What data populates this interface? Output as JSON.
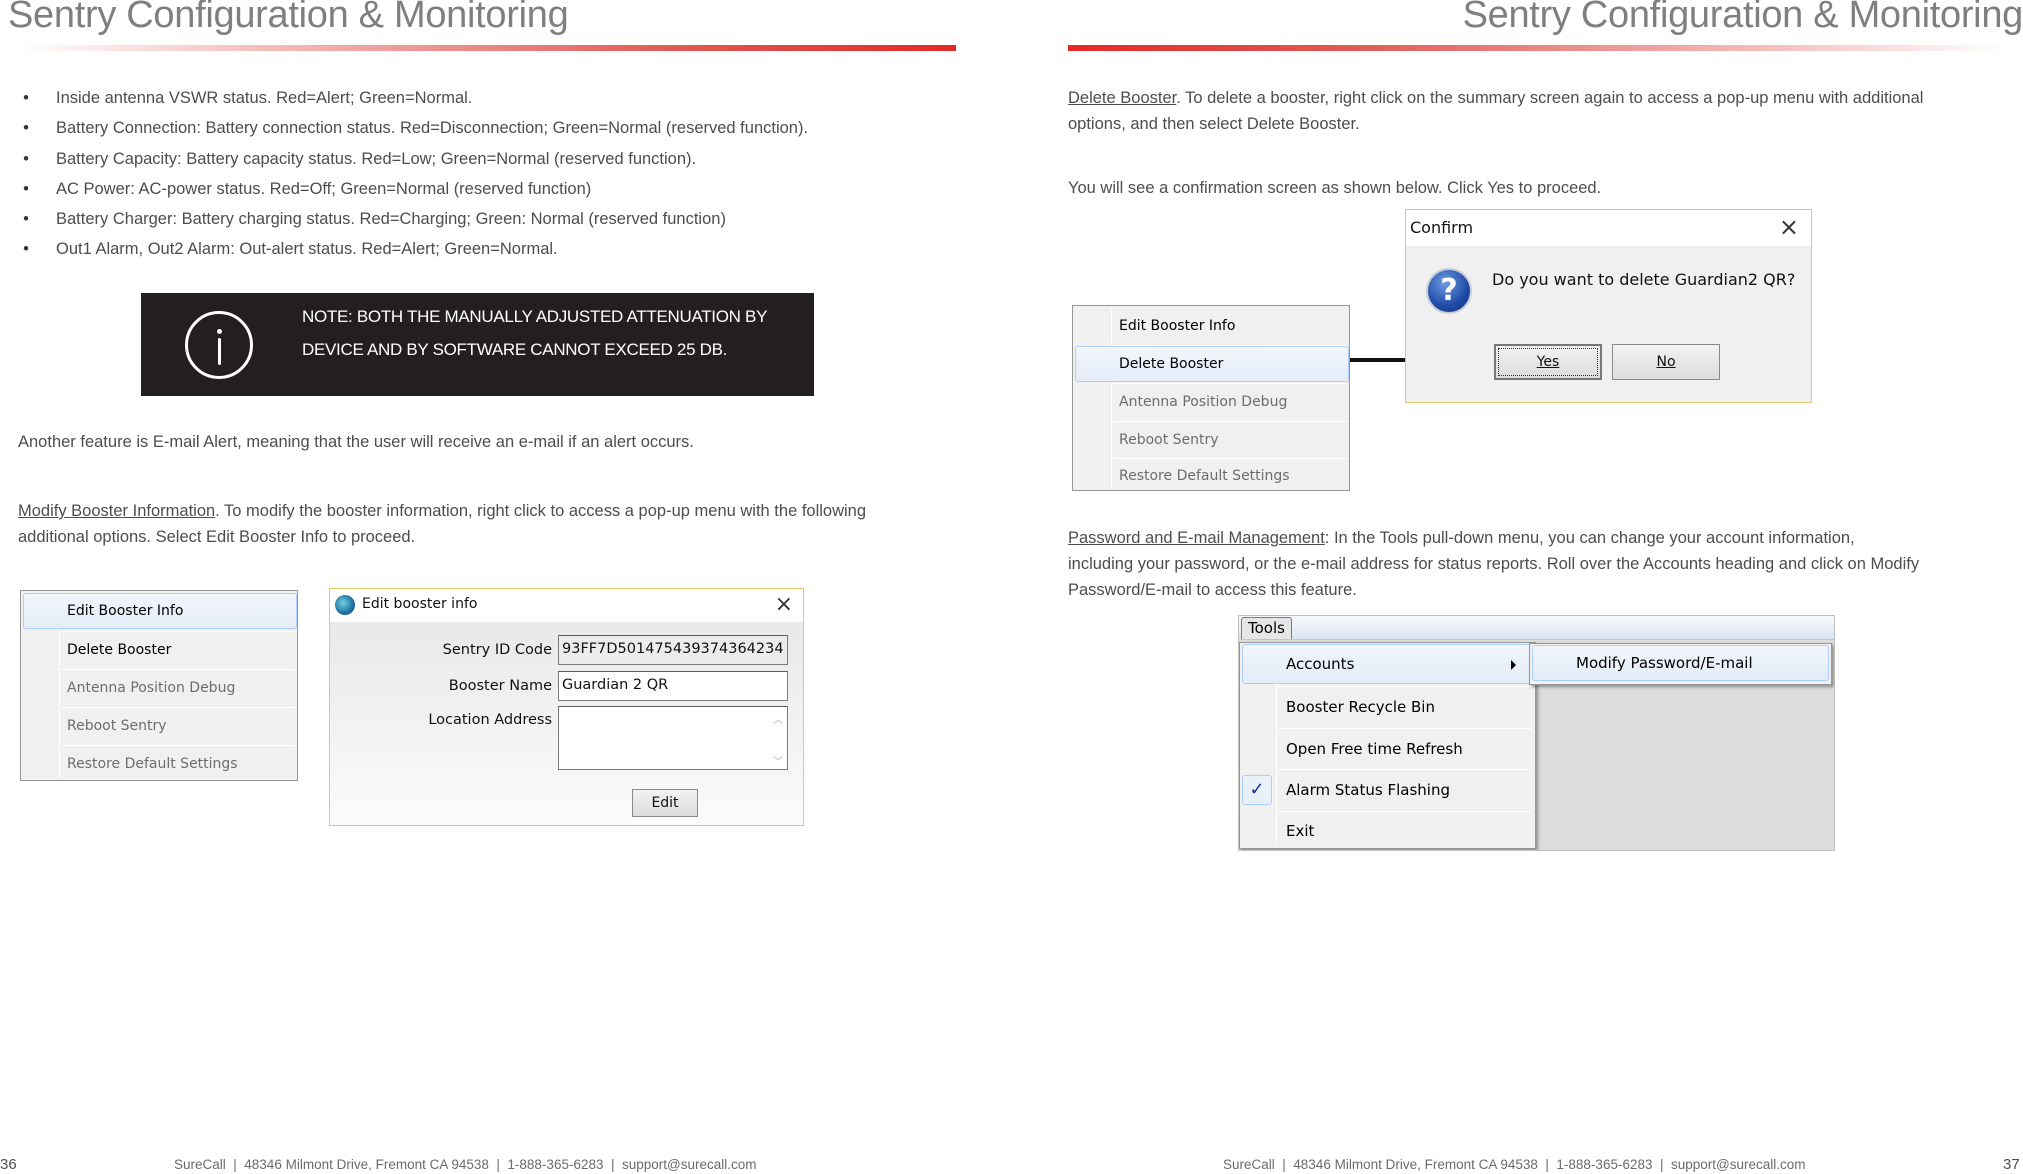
{
  "left_page": {
    "title": "Sentry Configuration & Monitoring",
    "bullets": [
      "Inside antenna VSWR status. Red=Alert; Green=Normal.",
      "Battery Connection: Battery connection status. Red=Disconnection; Green=Normal (reserved function).",
      "Battery Capacity: Battery capacity status. Red=Low; Green=Normal (reserved function).",
      "AC Power: AC-power status. Red=Off; Green=Normal (reserved function)",
      "Battery Charger: Battery charging status. Red=Charging; Green: Normal (reserved function)",
      "Out1 Alarm, Out2 Alarm: Out-alert status. Red=Alert; Green=Normal."
    ],
    "note": {
      "icon": "info-icon",
      "line1": "NOTE: BOTH THE MANUALLY ADJUSTED ATTENUATION BY",
      "line2": "DEVICE AND BY SOFTWARE CANNOT EXCEED 25 DB."
    },
    "email_alert_text": "Another feature is E-mail Alert, meaning that the user will receive an e-mail if an alert occurs.",
    "modify_section": {
      "link": "Modify Booster Information",
      "text_line1": ". To modify the booster information, right click to access a pop-up menu with the following",
      "text_line2": "additional options. Select Edit Booster Info to proceed."
    },
    "context_menu": {
      "items": [
        {
          "label": "Edit Booster Info",
          "state": "highlighted"
        },
        {
          "label": "Delete Booster",
          "state": "enabled"
        },
        {
          "label": "Antenna Position Debug",
          "state": "disabled"
        },
        {
          "label": "Reboot Sentry",
          "state": "disabled"
        },
        {
          "label": "Restore Default Settings",
          "state": "disabled"
        }
      ]
    },
    "edit_dialog": {
      "title": "Edit booster info",
      "close_icon": "×",
      "fields": [
        {
          "label": "Sentry ID Code",
          "value": "93FF7D501475439374364234"
        },
        {
          "label": "Booster Name",
          "value": "Guardian 2 QR"
        },
        {
          "label": "Location Address",
          "value": ""
        }
      ],
      "edit_button": "Edit"
    },
    "footer": "SureCall  |  48346 Milmont Drive, Fremont CA 94538  |  1-888-365-6283  |  support@surecall.com",
    "page_number": "36"
  },
  "right_page": {
    "title": "Sentry Configuration & Monitoring",
    "delete_section": {
      "link": "Delete Booster",
      "text_line1": ". To delete a booster, right click on the summary screen again to access a pop-up menu with additional",
      "text_line2": "options, and then select Delete Booster."
    },
    "confirm_text": "You will see a confirmation screen as shown below. Click Yes to proceed.",
    "context_menu": {
      "items": [
        {
          "label": "Edit Booster Info",
          "state": "enabled"
        },
        {
          "label": "Delete Booster",
          "state": "highlighted"
        },
        {
          "label": "Antenna Position Debug",
          "state": "disabled"
        },
        {
          "label": "Reboot Sentry",
          "state": "disabled"
        },
        {
          "label": "Restore Default Settings",
          "state": "disabled"
        }
      ]
    },
    "confirm_dialog": {
      "title": "Confirm",
      "close_icon": "×",
      "icon": "question-icon",
      "message": "Do you want to delete Guardian2  QR?",
      "yes_button": "Yes",
      "no_button": "No"
    },
    "password_section": {
      "link": "Password and E-mail Management",
      "text_line1": ": In the Tools pull-down menu, you can change your account information,",
      "text_line2": "including your password, or the e-mail address for status reports. Roll over the Accounts heading and click on Modify",
      "text_line3": "Password/E-mail to access this feature."
    },
    "tools_menu": {
      "menu_label": "Tools",
      "items": [
        {
          "label": "Accounts",
          "has_submenu": true,
          "state": "highlighted"
        },
        {
          "label": "Booster Recycle Bin"
        },
        {
          "label": "Open Free time Refresh"
        },
        {
          "label": "Alarm Status Flashing",
          "checked": true
        },
        {
          "label": "Exit"
        }
      ],
      "submenu": {
        "items": [
          {
            "label": "Modify Password/E-mail",
            "state": "highlighted"
          }
        ]
      },
      "check_glyph": "✓"
    },
    "footer": "SureCall  |  48346 Milmont Drive, Fremont CA 94538  |  1-888-365-6283  |  support@surecall.com",
    "page_number": "37"
  },
  "colors": {
    "accent_red": "#e32a25",
    "title_gray": "#7d7f82",
    "note_bg": "#231f20",
    "dialog_border": "#e8c66a",
    "menu_highlight_border": "#aecff7"
  }
}
